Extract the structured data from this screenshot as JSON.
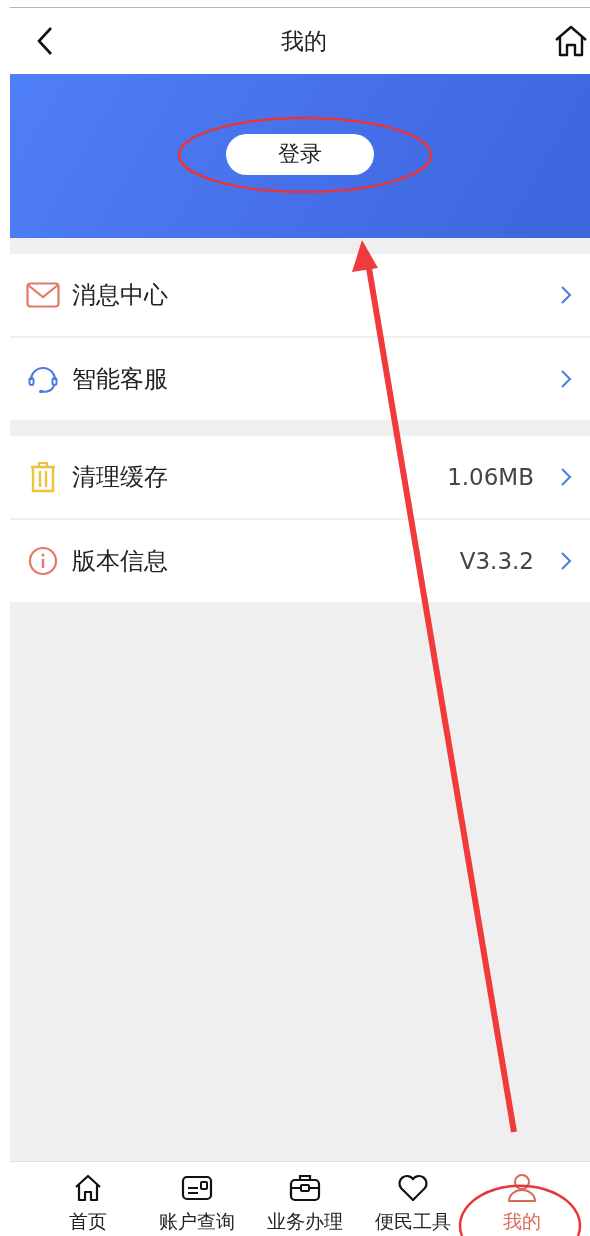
{
  "header": {
    "title": "我的"
  },
  "banner": {
    "login_button": "登录"
  },
  "menu_groups": [
    {
      "items": [
        {
          "kind": "mail",
          "label": "消息中心"
        },
        {
          "kind": "headset",
          "label": "智能客服"
        }
      ]
    },
    {
      "items": [
        {
          "kind": "trash",
          "label": "清理缓存",
          "value": "1.06MB"
        },
        {
          "kind": "info",
          "label": "版本信息",
          "value": "V3.3.2"
        }
      ]
    }
  ],
  "tab_bar": [
    {
      "kind": "home",
      "label": "首页",
      "selected": false
    },
    {
      "kind": "card",
      "label": "账户查询",
      "selected": false
    },
    {
      "kind": "briefcase",
      "label": "业务办理",
      "selected": false
    },
    {
      "kind": "heart",
      "label": "便民工具",
      "selected": false
    },
    {
      "kind": "person",
      "label": "我的",
      "selected": true
    }
  ]
}
